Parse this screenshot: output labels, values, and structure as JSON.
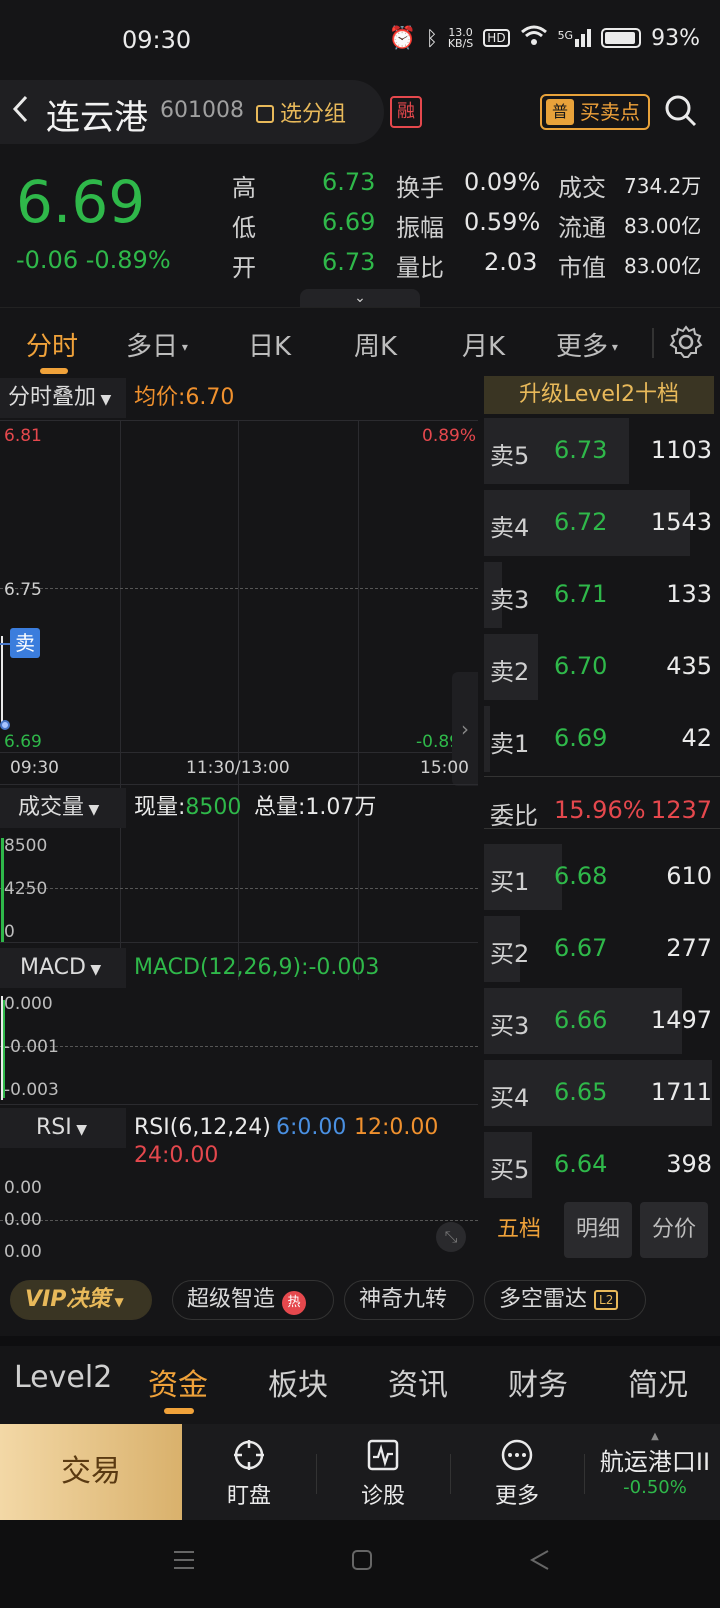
{
  "status_bar": {
    "time": "09:30",
    "net_speed": "13.0\nKB/S",
    "hd": "HD",
    "signal": "5G",
    "battery": "93%"
  },
  "header": {
    "name": "连云港",
    "code": "601008",
    "group_label": "选分组",
    "rong_badge": "融",
    "buy_sell_label": "买卖点",
    "buy_sell_icon": "普"
  },
  "quote": {
    "price": "6.69",
    "change": "-0.06 -0.89%",
    "stats": [
      {
        "label": "高",
        "value": "6.73"
      },
      {
        "label": "低",
        "value": "6.69"
      },
      {
        "label": "开",
        "value": "6.73"
      },
      {
        "label": "换手",
        "value": "0.09%"
      },
      {
        "label": "振幅",
        "value": "0.59%"
      },
      {
        "label": "量比",
        "value": "2.03"
      },
      {
        "label": "成交",
        "value": "734.2万"
      },
      {
        "label": "流通",
        "value": "83.00亿"
      },
      {
        "label": "市值",
        "value": "83.00亿"
      }
    ]
  },
  "tabs": [
    "分时",
    "多日",
    "日K",
    "周K",
    "月K",
    "更多"
  ],
  "chart": {
    "overlay_label": "分时叠加",
    "avg_label": "均价:6.70",
    "y_top": "6.81",
    "y_mid": "6.75",
    "y_bottom": "6.69",
    "pct_top": "0.89%",
    "pct_bottom": "-0.89%",
    "sell_marker": "卖",
    "x_labels": [
      "09:30",
      "11:30/13:00",
      "15:00"
    ]
  },
  "volume": {
    "label": "成交量",
    "now_label": "现量:",
    "now_value": "8500",
    "total": "总量:1.07万",
    "ticks": [
      "8500",
      "4250",
      "0"
    ]
  },
  "macd": {
    "label": "MACD",
    "value": "MACD(12,26,9):-0.003",
    "ticks": [
      "0.000",
      "-0.001",
      "-0.003"
    ]
  },
  "rsi": {
    "label": "RSI",
    "params": "RSI(6,12,24)",
    "r6": "6:0.00",
    "r12": "12:0.00",
    "r24": "24:0.00",
    "ticks": [
      "0.00",
      "0.00",
      "0.00"
    ]
  },
  "order_book": {
    "header": "升级Level2十档",
    "sells": [
      {
        "label": "卖5",
        "price": "6.73",
        "vol": "1103"
      },
      {
        "label": "卖4",
        "price": "6.72",
        "vol": "1543"
      },
      {
        "label": "卖3",
        "price": "6.71",
        "vol": "133"
      },
      {
        "label": "卖2",
        "price": "6.70",
        "vol": "435"
      },
      {
        "label": "卖1",
        "price": "6.69",
        "vol": "42"
      }
    ],
    "weibi": {
      "label": "委比",
      "pct": "15.96%",
      "diff": "1237"
    },
    "buys": [
      {
        "label": "买1",
        "price": "6.68",
        "vol": "610"
      },
      {
        "label": "买2",
        "price": "6.67",
        "vol": "277"
      },
      {
        "label": "买3",
        "price": "6.66",
        "vol": "1497"
      },
      {
        "label": "买4",
        "price": "6.65",
        "vol": "1711"
      },
      {
        "label": "买5",
        "price": "6.64",
        "vol": "398"
      }
    ],
    "sub_tabs": [
      "五档",
      "明细",
      "分价"
    ]
  },
  "features": {
    "vip": "VIP决策",
    "f1": "超级智造",
    "f1_badge": "热",
    "f2": "神奇九转",
    "f3": "多空雷达",
    "f3_badge": "L2"
  },
  "bottom_tabs": [
    "Level2",
    "资金",
    "板块",
    "资讯",
    "财务",
    "简况"
  ],
  "action_bar": {
    "trade": "交易",
    "watch": "盯盘",
    "diagnose": "诊股",
    "more": "更多",
    "ticker_name": "航运港口II",
    "ticker_change": "-0.50%"
  }
}
